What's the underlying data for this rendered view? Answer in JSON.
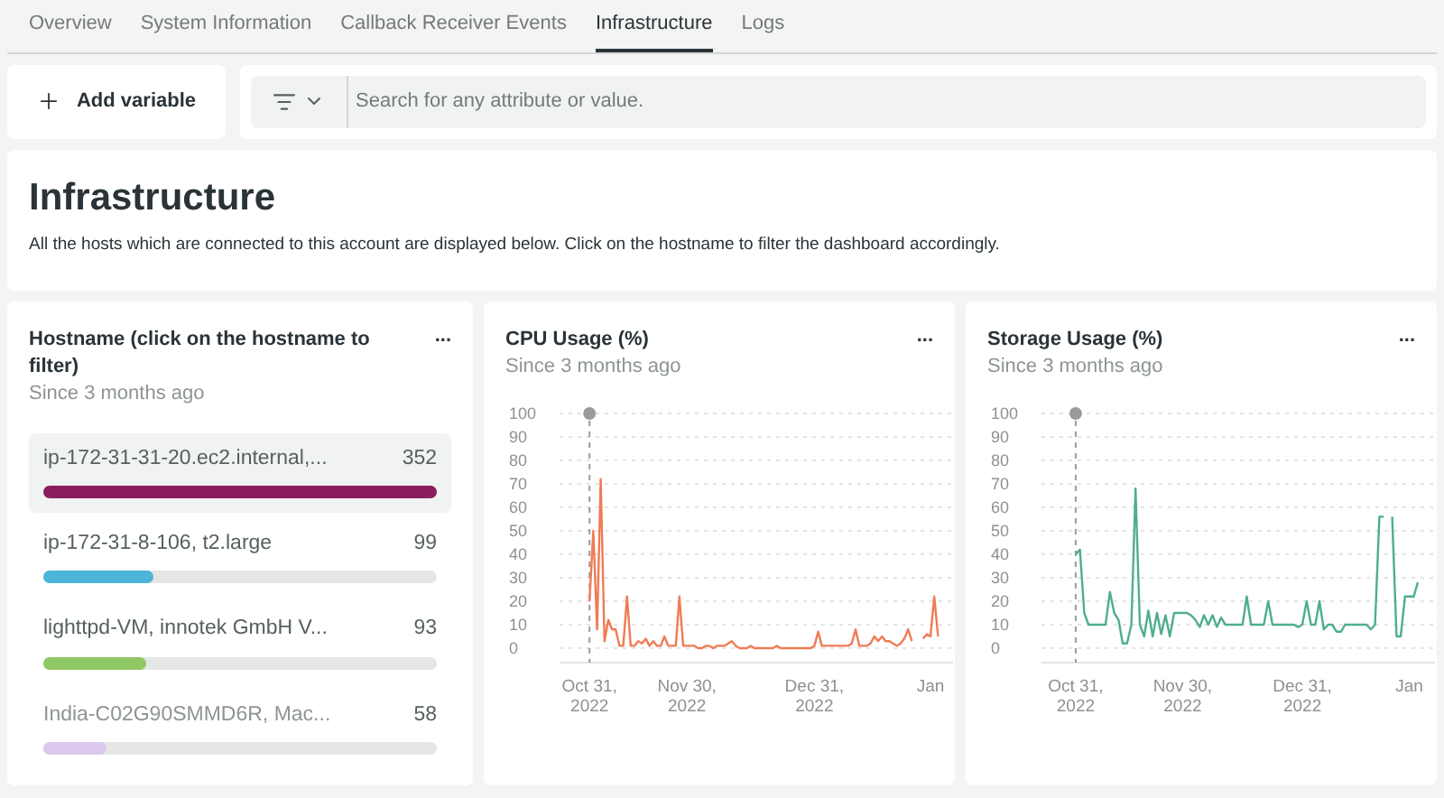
{
  "tabs": [
    {
      "label": "Overview",
      "selected": false
    },
    {
      "label": "System Information",
      "selected": false
    },
    {
      "label": "Callback Receiver Events",
      "selected": false
    },
    {
      "label": "Infrastructure",
      "selected": true
    },
    {
      "label": "Logs",
      "selected": false
    }
  ],
  "add_variable": {
    "label": "Add variable"
  },
  "search": {
    "placeholder": "Search for any attribute or value."
  },
  "header": {
    "title": "Infrastructure",
    "description": "All the hosts which are connected to this account are displayed below. Click on the hostname to filter the dashboard accordingly."
  },
  "hosts_card": {
    "title": "Hostname (click on the hostname to filter)",
    "subtitle": "Since 3 months ago",
    "menu": "...",
    "items": [
      {
        "name": "ip-172-31-31-20.ec2.internal,...",
        "value": "352",
        "level": 1,
        "color": "#8a1e5c",
        "selected": true
      },
      {
        "name": "ip-172-31-8-106, t2.large",
        "value": "99",
        "level": 0.28,
        "color": "#4bb4d8",
        "selected": false
      },
      {
        "name": "lighttpd-VM, innotek GmbH V...",
        "value": "93",
        "level": 0.26,
        "color": "#90c865",
        "selected": false
      },
      {
        "name": "India-C02G90SMMD6R, Mac...",
        "value": "58",
        "level": 0.16,
        "color": "#dcc8ec",
        "selected": false
      }
    ]
  },
  "charts": [
    {
      "title": "CPU Usage (%)",
      "subtitle": "Since 3 months ago",
      "menu": "...",
      "chart_data": {
        "type": "line",
        "categories": [
          "Oct 31, 2022",
          null,
          null,
          null,
          null,
          null,
          null,
          null,
          null,
          null,
          null,
          null,
          null,
          null,
          null,
          null,
          null,
          null,
          null,
          null,
          null,
          null,
          null,
          null,
          null,
          null,
          "Nov 30, 2022",
          null,
          null,
          null,
          null,
          null,
          null,
          null,
          null,
          null,
          null,
          null,
          null,
          null,
          null,
          null,
          null,
          null,
          null,
          null,
          null,
          null,
          null,
          null,
          null,
          null,
          null,
          null,
          null,
          null,
          null,
          null,
          null,
          null,
          "Dec 31, 2022",
          null,
          null,
          null,
          null,
          null,
          null,
          null,
          null,
          null,
          null,
          null,
          null,
          null,
          null,
          null,
          null,
          null,
          null,
          null,
          null,
          null,
          null,
          null,
          null,
          null,
          null,
          null,
          null,
          null,
          null,
          "Jan",
          null,
          null
        ],
        "grid": true,
        "ref_lines": [
          {
            "axis": "x",
            "value": "Oct 31, 2022"
          }
        ],
        "series": [
          {
            "color": "#f07b55",
            "values": [
              20,
              50,
              8,
              72,
              3,
              12,
              8,
              8,
              1,
              1,
              22,
              1,
              1,
              3,
              2,
              4,
              1,
              3,
              1,
              1,
              5,
              1,
              1,
              1,
              22,
              1,
              1,
              1,
              1,
              0,
              0,
              1,
              1,
              0,
              1,
              1,
              1,
              2,
              3,
              1,
              0,
              0,
              0,
              1,
              0,
              0,
              0,
              0,
              0,
              0,
              1,
              0,
              0,
              0,
              0,
              0,
              0,
              0,
              0,
              0,
              1,
              7,
              1,
              1,
              1,
              1,
              1,
              1,
              1,
              1,
              2,
              8,
              1,
              1,
              1,
              2,
              5,
              3,
              5,
              3,
              3,
              2,
              1,
              2,
              4,
              8,
              3,
              null,
              null,
              4,
              6,
              5,
              22,
              5
            ]
          }
        ],
        "ylim": [
          0,
          100
        ],
        "yticks": [
          0,
          10,
          20,
          30,
          40,
          50,
          60,
          70,
          80,
          90,
          100
        ]
      }
    },
    {
      "title": "Storage Usage (%)",
      "subtitle": "Since 3 months ago",
      "menu": "...",
      "chart_data": {
        "type": "line",
        "categories": [
          "Oct 31, 2022",
          null,
          null,
          null,
          null,
          null,
          null,
          null,
          null,
          null,
          null,
          null,
          null,
          null,
          null,
          null,
          null,
          null,
          null,
          null,
          null,
          null,
          null,
          null,
          null,
          "Nov 30, 2022",
          null,
          null,
          null,
          null,
          null,
          null,
          null,
          null,
          null,
          null,
          null,
          null,
          null,
          null,
          null,
          null,
          null,
          null,
          null,
          null,
          null,
          null,
          null,
          null,
          null,
          null,
          null,
          "Dec 31, 2022",
          null,
          null,
          null,
          null,
          null,
          null,
          null,
          null,
          null,
          null,
          null,
          null,
          null,
          null,
          null,
          null,
          null,
          null,
          null,
          null,
          null,
          null,
          null,
          null,
          "Jan",
          null,
          null
        ],
        "grid": true,
        "ref_lines": [
          {
            "axis": "x",
            "value": "Oct 31, 2022"
          }
        ],
        "series": [
          {
            "color": "#4fae8e",
            "values": [
              40,
              42,
              15,
              10,
              10,
              10,
              10,
              10,
              24,
              15,
              12,
              2,
              2,
              10,
              68,
              10,
              5,
              16,
              5,
              15,
              6,
              14,
              5,
              15,
              15,
              15,
              15,
              14,
              12,
              9,
              14,
              10,
              14,
              9,
              13,
              10,
              10,
              10,
              10,
              10,
              22,
              10,
              10,
              10,
              10,
              20,
              10,
              10,
              10,
              10,
              10,
              10,
              9,
              10,
              20,
              10,
              10,
              20,
              8,
              10,
              10,
              7,
              7,
              10,
              10,
              10,
              10,
              10,
              10,
              8,
              10,
              56,
              56,
              null,
              56,
              5,
              5,
              22,
              22,
              22,
              28
            ]
          }
        ],
        "ylim": [
          0,
          100
        ],
        "yticks": [
          0,
          10,
          20,
          30,
          40,
          50,
          60,
          70,
          80,
          90,
          100
        ]
      }
    }
  ]
}
